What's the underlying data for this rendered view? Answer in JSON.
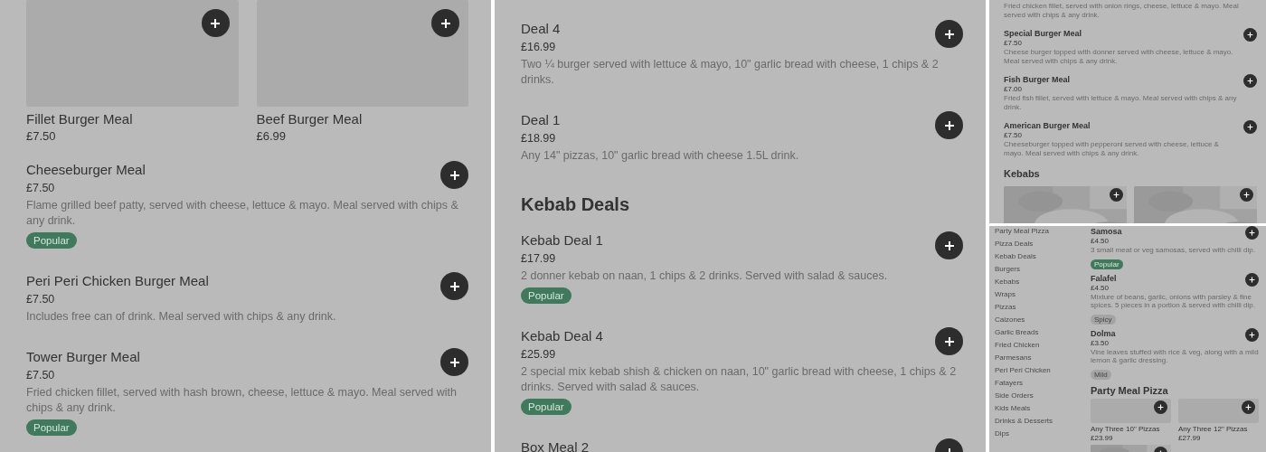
{
  "panels": [
    {
      "blocks": [
        {
          "kind": "cards",
          "cards": [
            {
              "name": "Fillet Burger Meal",
              "price": "£7.50"
            },
            {
              "name": "Beef Burger Meal",
              "price": "£6.99"
            }
          ]
        },
        {
          "kind": "item",
          "name": "Cheeseburger Meal",
          "price": "£7.50",
          "description": "Flame grilled beef patty, served with cheese, lettuce & mayo. Meal served with chips & any drink.",
          "badge": {
            "label": "Popular",
            "kind": "popular"
          }
        },
        {
          "kind": "item",
          "name": "Peri Peri Chicken Burger Meal",
          "price": "£7.50",
          "description": "Includes free can of drink. Meal served with chips & any drink."
        },
        {
          "kind": "item",
          "name": "Tower Burger Meal",
          "price": "£7.50",
          "description": "Fried chicken fillet, served with hash brown, cheese, lettuce & mayo. Meal served with chips & any drink.",
          "badge": {
            "label": "Popular",
            "kind": "popular"
          }
        }
      ]
    },
    {
      "blocks": [
        {
          "kind": "item",
          "name": "Deal 4",
          "price": "£16.99",
          "description": "Two ¼ burger served with lettuce & mayo, 10\" garlic bread with cheese, 1 chips & 2 drinks."
        },
        {
          "kind": "item",
          "name": "Deal 1",
          "price": "£18.99",
          "description": "Any 14\" pizzas, 10\" garlic bread with cheese 1.5L drink."
        },
        {
          "kind": "heading",
          "text": "Kebab Deals"
        },
        {
          "kind": "item",
          "name": "Kebab Deal 1",
          "price": "£17.99",
          "description": "2 donner kebab on naan, 1 chips & 2 drinks. Served with salad & sauces.",
          "badge": {
            "label": "Popular",
            "kind": "popular"
          }
        },
        {
          "kind": "item",
          "name": "Kebab Deal 4",
          "price": "£25.99",
          "description": "2 special mix kebab shish & chicken on naan, 10\" garlic bread with cheese, 1 chips & 2 drinks. Served with salad & sauces.",
          "badge": {
            "label": "Popular",
            "kind": "popular"
          }
        },
        {
          "kind": "item",
          "name": "Box Meal 2"
        }
      ]
    },
    {
      "blocks": [
        {
          "kind": "item",
          "description": "Fried chicken fillet, served with onion rings, cheese, lettuce & mayo. Meal served with chips & any drink."
        },
        {
          "kind": "item",
          "name": "Special Burger Meal",
          "price": "£7.50",
          "description": "Cheese burger topped with donner served with cheese, lettuce & mayo. Meal served with chips & any drink."
        },
        {
          "kind": "item",
          "name": "Fish Burger Meal",
          "price": "£7.00",
          "description": "Fried fish fillet, served with lettuce & mayo. Meal served with chips & any drink."
        },
        {
          "kind": "item",
          "name": "American Burger Meal",
          "price": "£7.50",
          "description": "Cheeseburger topped with pepperoni served with cheese, lettuce & mayo. Meal served with chips & any drink."
        },
        {
          "kind": "heading",
          "text": "Kebabs"
        },
        {
          "kind": "cards",
          "cards": [
            {
              "kind": "picture"
            },
            {
              "kind": "picture"
            }
          ]
        }
      ]
    },
    {
      "sidebar": {
        "items": [
          "Party Meal Pizza",
          "Pizza Deals",
          "Kebab Deals",
          "Burgers",
          "Kebabs",
          "Wraps",
          "Pizzas",
          "Calzones",
          "Garlic Breads",
          "Fried Chicken",
          "Parmesans",
          "Peri Peri Chicken",
          "Fatayers",
          "Side Orders",
          "Kids Meals",
          "Drinks & Desserts",
          "Dips"
        ]
      },
      "blocks": [
        {
          "kind": "item",
          "name": "Samosa",
          "price": "£4.50",
          "description": "3 small meat or veg samosas, served with chilli dip.",
          "badge": {
            "label": "Popular",
            "kind": "popular"
          }
        },
        {
          "kind": "item",
          "name": "Falafel",
          "price": "£4.50",
          "description": "Mixture of beans, garlic, onions with parsley & fine spices. 5 pieces in a portion & served with chilli dip.",
          "badge": {
            "label": "Spicy",
            "kind": "tag"
          }
        },
        {
          "kind": "item",
          "name": "Dolma",
          "price": "£3.50",
          "description": "Vine leaves stuffed with rice & veg, along with a mild lemon & garlic dressing.",
          "badge": {
            "label": "Mild",
            "kind": "tag"
          }
        },
        {
          "kind": "heading",
          "text": "Party Meal Pizza"
        },
        {
          "kind": "cards",
          "cards": [
            {
              "name": "Any Three 10\" Pizzas",
              "price": "£23.99"
            },
            {
              "name": "Any Three 12\" Pizzas",
              "price": "£27.99"
            },
            {
              "kind": "picture"
            }
          ]
        }
      ]
    }
  ]
}
